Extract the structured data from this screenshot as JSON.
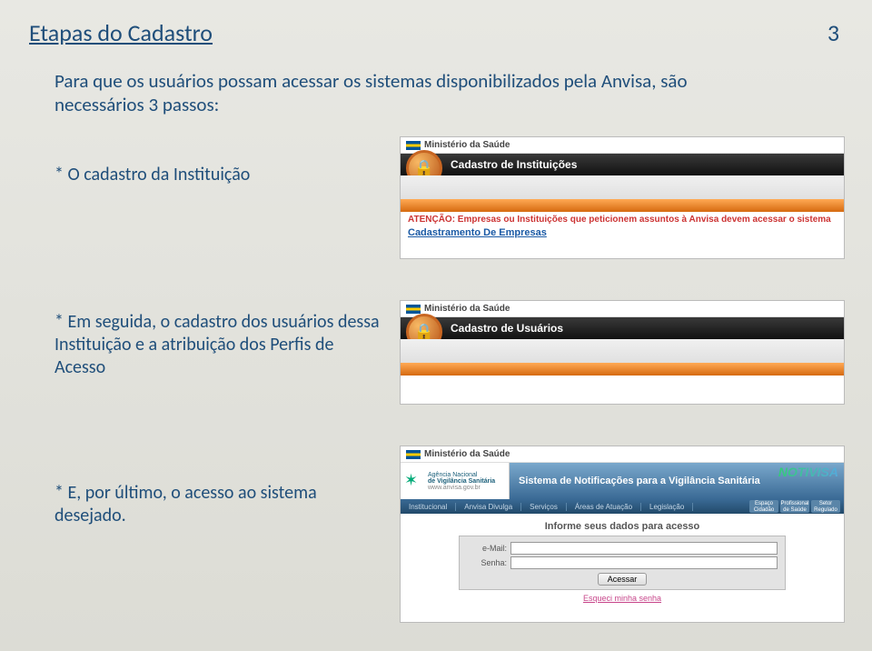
{
  "page": {
    "title": "Etapas do Cadastro",
    "number": "3"
  },
  "intro": "Para que os usuários possam acessar os sistemas disponibilizados pela Anvisa, são necessários 3 passos:",
  "steps": {
    "s1": "* O cadastro da Instituição",
    "s2": "* Em seguida,  o cadastro dos usuários dessa Instituição e a atribuição dos Perfis de Acesso",
    "s3": "* E, por último, o acesso ao sistema desejado."
  },
  "panel1": {
    "ministry": "Ministério da Saúde",
    "header": "Cadastro de Instituições",
    "attention": "ATENÇÃO: Empresas ou Instituições que peticionem assuntos à Anvisa devem acessar o sistema",
    "link": "Cadastramento De Empresas"
  },
  "panel2": {
    "ministry": "Ministério da Saúde",
    "header": "Cadastro de Usuários"
  },
  "panel3": {
    "ministry": "Ministério da Saúde",
    "agency_l1": "Agência Nacional",
    "agency_l2": "de Vigilância Sanitária",
    "agency_url": "www.anvisa.gov.br",
    "system_title": "Sistema de Notificações para a Vigilância Sanitária",
    "brand": "NOTIVISA",
    "tabs": [
      "Institucional",
      "Anvisa Divulga",
      "Serviços",
      "Áreas de Atuação",
      "Legislação"
    ],
    "right_icons": [
      "Espaço Cidadão",
      "Profissional de Saúde",
      "Setor Regulado"
    ],
    "form_title": "Informe seus dados para acesso",
    "email_label": "e-Mail:",
    "senha_label": "Senha:",
    "btn": "Acessar",
    "forgot": "Esqueci minha senha"
  }
}
